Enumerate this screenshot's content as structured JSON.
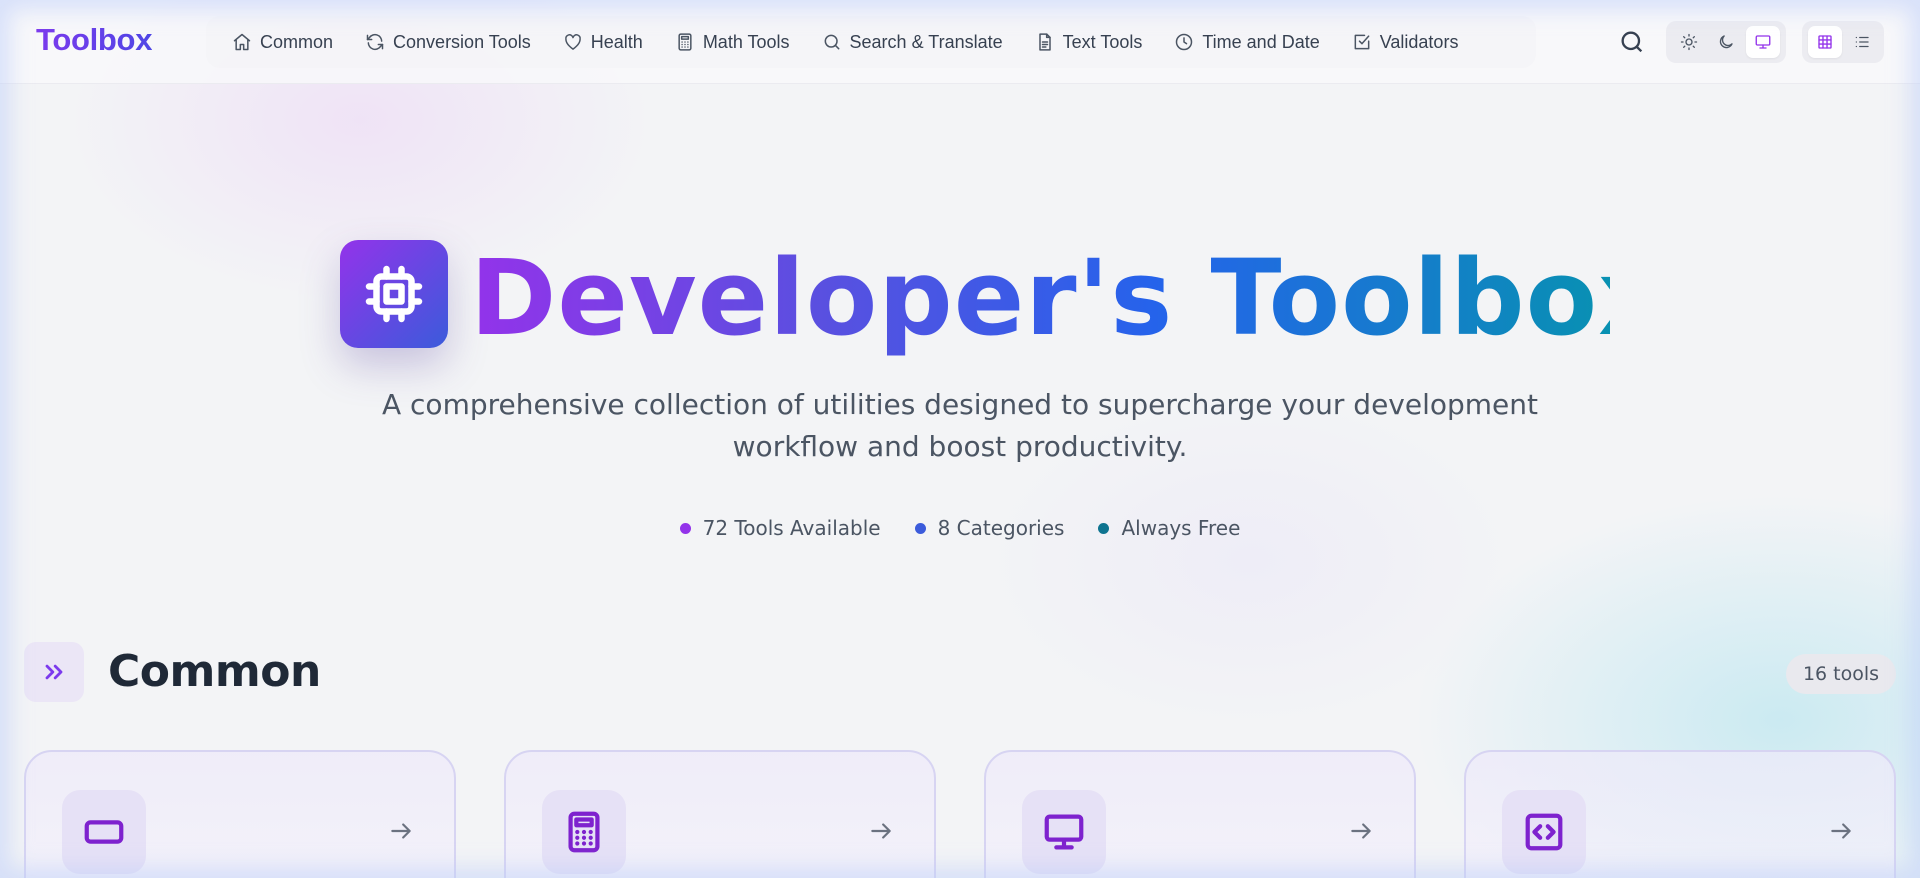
{
  "brand": "Toolbox",
  "nav": {
    "links": [
      {
        "label": "Common",
        "icon": "home-icon"
      },
      {
        "label": "Conversion Tools",
        "icon": "refresh-icon"
      },
      {
        "label": "Health",
        "icon": "heart-icon"
      },
      {
        "label": "Math Tools",
        "icon": "calculator-icon"
      },
      {
        "label": "Search & Translate",
        "icon": "search-icon"
      },
      {
        "label": "Text Tools",
        "icon": "document-icon"
      },
      {
        "label": "Time and Date",
        "icon": "clock-icon"
      },
      {
        "label": "Validators",
        "icon": "check-square-icon"
      }
    ],
    "theme_options": [
      "light",
      "dark",
      "system"
    ],
    "theme_selected": "system",
    "view_options": [
      "grid",
      "list"
    ],
    "view_selected": "grid"
  },
  "hero": {
    "title": "Developer's Toolbox",
    "subtitle": "A comprehensive collection of utilities designed to supercharge your development workflow and boost productivity.",
    "stats": [
      {
        "label": "72 Tools Available",
        "color": "#9333ea"
      },
      {
        "label": "8 Categories",
        "color": "#3b5bdb"
      },
      {
        "label": "Always Free",
        "color": "#0e7490"
      }
    ]
  },
  "section": {
    "title": "Common",
    "count": "16 tools",
    "cards": [
      {
        "icon": "rectangle-icon"
      },
      {
        "icon": "calculator-icon"
      },
      {
        "icon": "monitor-icon"
      },
      {
        "icon": "code-icon"
      }
    ]
  },
  "colors": {
    "accent_purple": "#9333ea",
    "accent_blue": "#2563eb",
    "accent_teal": "#0891b2"
  }
}
